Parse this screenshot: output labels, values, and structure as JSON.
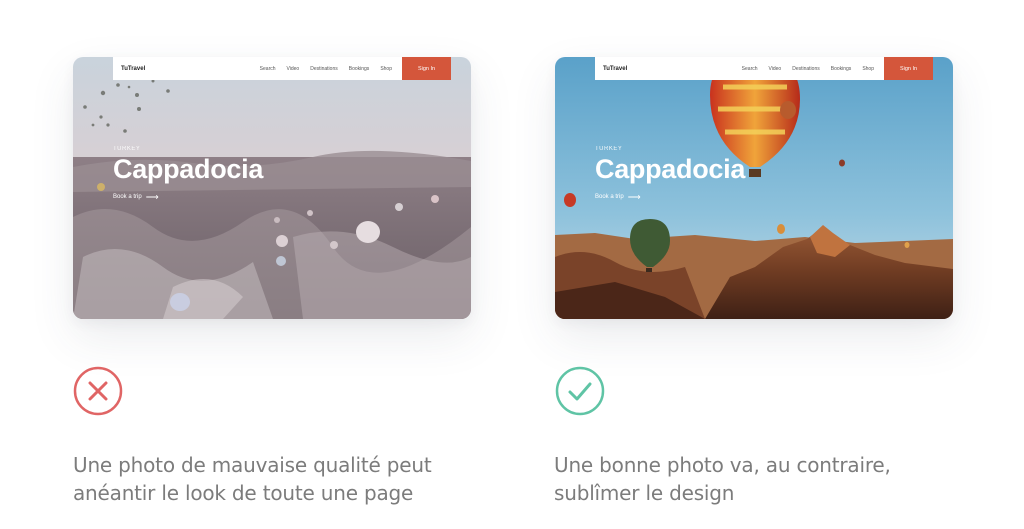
{
  "mockups": {
    "bad": {
      "brand": "TuTravel",
      "nav": [
        "Search",
        "Video",
        "Destinations",
        "Bookings",
        "Shop"
      ],
      "signin": "Sign In",
      "eyebrow": "TURKEY",
      "title": "Cappadocia",
      "cta": "Book a trip",
      "cta_arrow": "⟶"
    },
    "good": {
      "brand": "TuTravel",
      "nav": [
        "Search",
        "Video",
        "Destinations",
        "Bookings",
        "Shop"
      ],
      "signin": "Sign In",
      "eyebrow": "TURKEY",
      "title": "Cappadocia",
      "cta": "Book a trip",
      "cta_arrow": "⟶"
    }
  },
  "verdict": {
    "bad": {
      "icon": "cross-icon",
      "color": "#e06565"
    },
    "good": {
      "icon": "check-icon",
      "color": "#5fc4a5"
    }
  },
  "captions": {
    "bad": {
      "line1": "Une photo de mauvaise qualité peut",
      "line2": "anéantir le look de toute une page"
    },
    "good": {
      "line1": "Une bonne photo va, au contraire,",
      "line2": "sublîmer le design"
    }
  },
  "colors": {
    "accent": "#d4563b",
    "caption_text": "#7c7c7c"
  }
}
